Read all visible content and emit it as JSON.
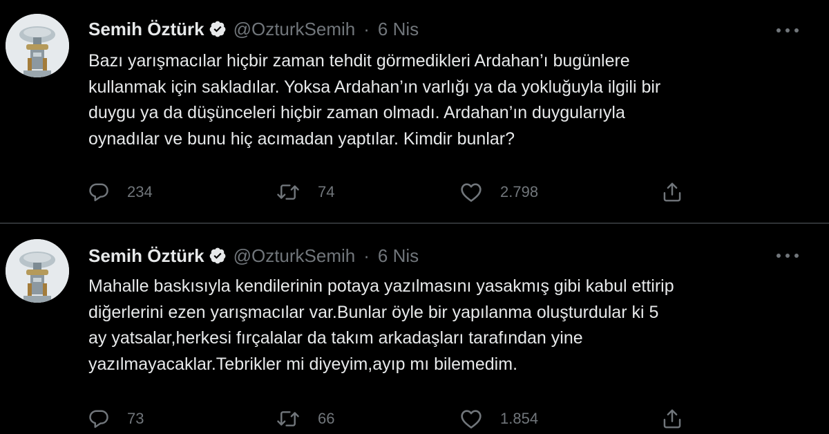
{
  "colors": {
    "background": "#000000",
    "text": "#e7e9ea",
    "muted": "#71767b",
    "divider": "#2f3336"
  },
  "icons": [
    "verified-badge-icon",
    "more-icon",
    "reply-icon",
    "retweet-icon",
    "like-icon",
    "share-icon"
  ],
  "tweets": [
    {
      "name": "Semih Öztürk",
      "handle": "@OzturkSemih",
      "separator": "·",
      "date": "6 Nis",
      "lines": [
        "Bazı yarışmacılar hiçbir zaman tehdit görmedikleri Ardahan’ı bugünlere",
        "kullanmak için sakladılar. Yoksa Ardahan’ın varlığı ya da yokluğuyla ilgili bir",
        "duygu ya da düşünceleri hiçbir zaman olmadı. Ardahan’ın duygularıyla",
        "oynadılar ve bunu hiç acımadan yaptılar. Kimdir bunlar?"
      ],
      "replies": "234",
      "retweets": "74",
      "likes": "2.798"
    },
    {
      "name": "Semih Öztürk",
      "handle": "@OzturkSemih",
      "separator": "·",
      "date": "6 Nis",
      "lines": [
        "Mahalle baskısıyla kendilerinin potaya yazılmasını yasakmış gibi kabul ettirip",
        "diğerlerini ezen yarışmacılar var.Bunlar öyle bir yapılanma oluşturdular ki 5",
        "ay yatsalar,herkesi fırçalalar da takım arkadaşları tarafından yine",
        "yazılmayacaklar.Tebrikler mi diyeyim,ayıp mı bilemedim."
      ],
      "replies": "73",
      "retweets": "66",
      "likes": "1.854"
    }
  ]
}
